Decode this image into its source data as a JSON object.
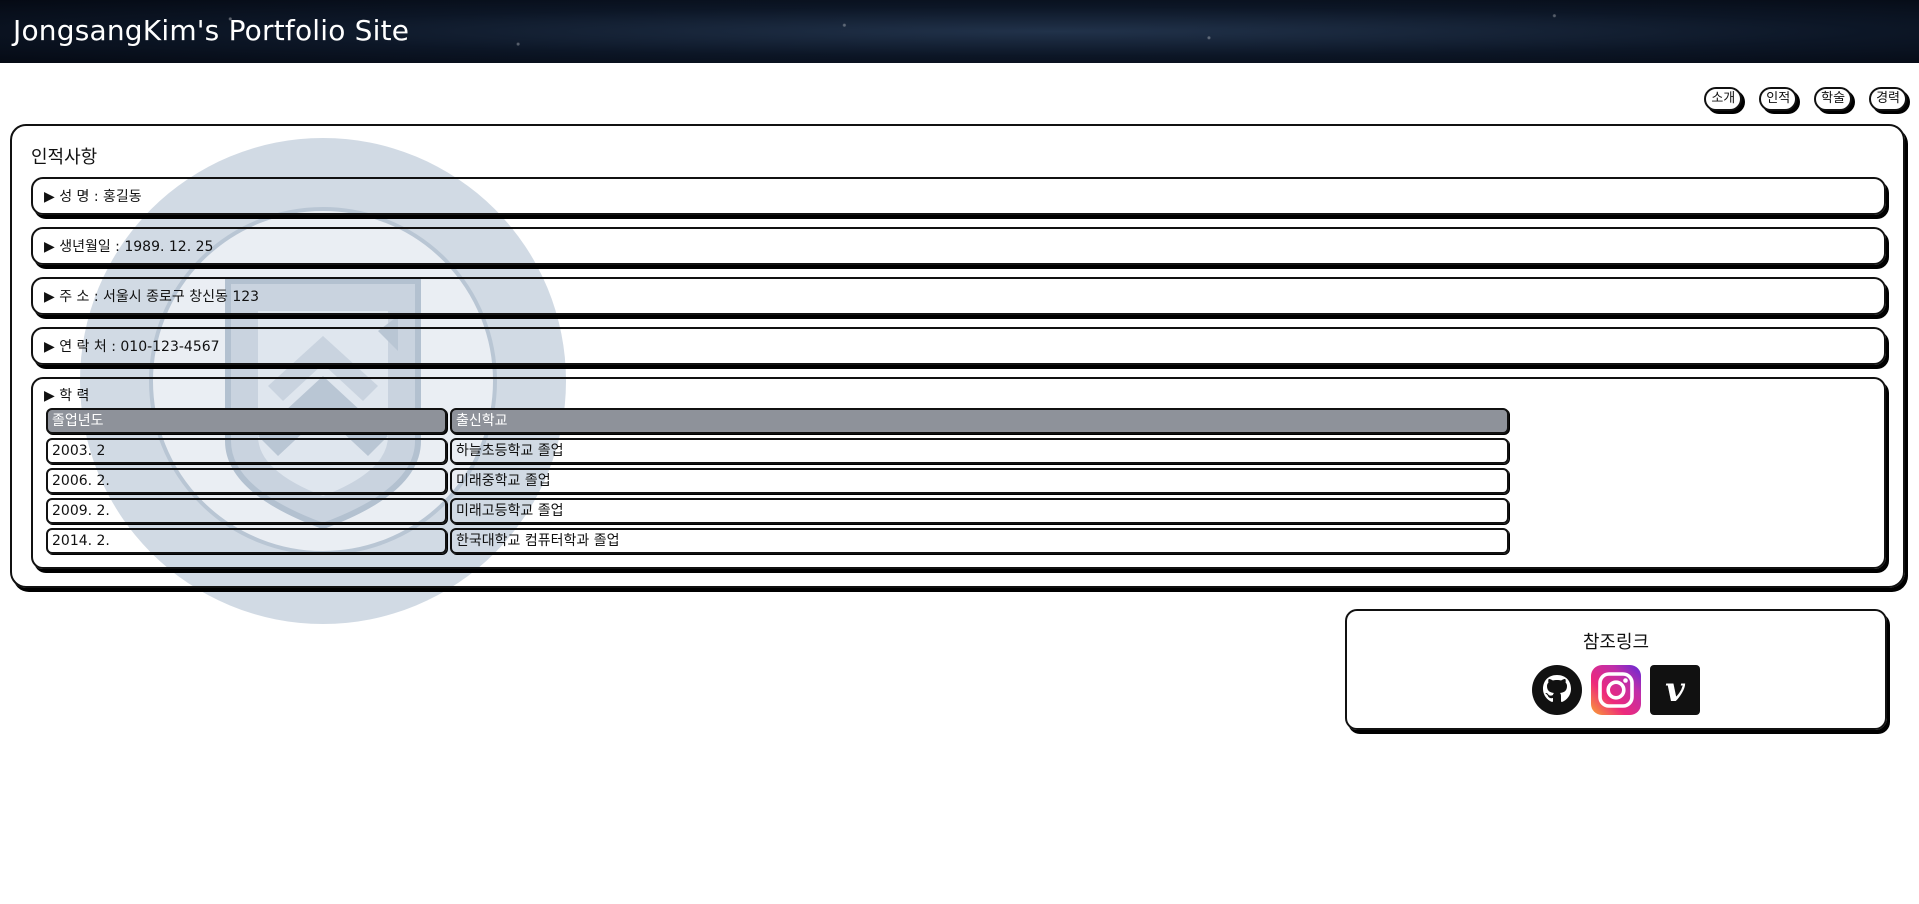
{
  "header": {
    "title": "JongsangKim's Portfolio Site"
  },
  "nav": {
    "items": [
      "소개",
      "인적",
      "학술",
      "경력"
    ]
  },
  "personal": {
    "title": "인적사항",
    "rows": [
      "▶ 성 명 : 홍길동",
      "▶ 생년월일 : 1989. 12. 25",
      "▶ 주 소 : 서울시 종로구 창신동 123",
      "▶ 연 락 처 : 010-123-4567"
    ],
    "education": {
      "label": "▶ 학 력",
      "headers": [
        "졸업년도",
        "출신학교"
      ],
      "rows": [
        [
          "2003. 2",
          "하늘초등학교 졸업"
        ],
        [
          "2006. 2.",
          "미래중학교 졸업"
        ],
        [
          "2009. 2.",
          "미래고등학교 졸업"
        ],
        [
          "2014. 2.",
          "한국대학교 컴퓨터학과 졸업"
        ]
      ]
    }
  },
  "links": {
    "title": "참조링크",
    "icons": [
      "github-icon",
      "instagram-icon",
      "vimeo-icon"
    ]
  },
  "colors": {
    "header_bg": "#0c1626",
    "table_header_bg": "#8e929a",
    "emblem": "#c9d3df"
  }
}
